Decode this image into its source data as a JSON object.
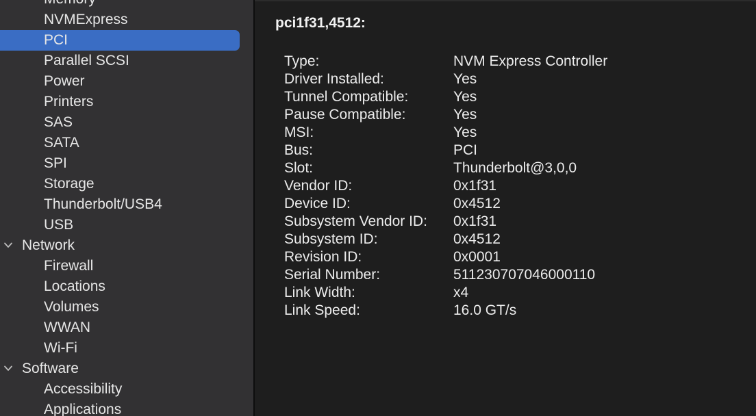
{
  "sidebar": {
    "items": [
      {
        "label": "Memory",
        "kind": "child"
      },
      {
        "label": "NVMExpress",
        "kind": "child"
      },
      {
        "label": "PCI",
        "kind": "child",
        "selected": true
      },
      {
        "label": "Parallel SCSI",
        "kind": "child"
      },
      {
        "label": "Power",
        "kind": "child"
      },
      {
        "label": "Printers",
        "kind": "child"
      },
      {
        "label": "SAS",
        "kind": "child"
      },
      {
        "label": "SATA",
        "kind": "child"
      },
      {
        "label": "SPI",
        "kind": "child"
      },
      {
        "label": "Storage",
        "kind": "child"
      },
      {
        "label": "Thunderbolt/USB4",
        "kind": "child"
      },
      {
        "label": "USB",
        "kind": "child"
      },
      {
        "label": "Network",
        "kind": "group"
      },
      {
        "label": "Firewall",
        "kind": "child"
      },
      {
        "label": "Locations",
        "kind": "child"
      },
      {
        "label": "Volumes",
        "kind": "child"
      },
      {
        "label": "WWAN",
        "kind": "child"
      },
      {
        "label": "Wi-Fi",
        "kind": "child"
      },
      {
        "label": "Software",
        "kind": "group"
      },
      {
        "label": "Accessibility",
        "kind": "child"
      },
      {
        "label": "Applications",
        "kind": "child"
      }
    ],
    "selected_color": "#3a6dc4",
    "background_color": "#323133",
    "group_icon": "chevron-down-icon"
  },
  "detail": {
    "title": "pci1f31,4512:",
    "properties": [
      {
        "key": "Type:",
        "value": "NVM Express Controller"
      },
      {
        "key": "Driver Installed:",
        "value": "Yes"
      },
      {
        "key": "Tunnel Compatible:",
        "value": "Yes"
      },
      {
        "key": "Pause Compatible:",
        "value": "Yes"
      },
      {
        "key": "MSI:",
        "value": "Yes"
      },
      {
        "key": "Bus:",
        "value": "PCI"
      },
      {
        "key": "Slot:",
        "value": "Thunderbolt@3,0,0"
      },
      {
        "key": "Vendor ID:",
        "value": "0x1f31"
      },
      {
        "key": "Device ID:",
        "value": "0x4512"
      },
      {
        "key": "Subsystem Vendor ID:",
        "value": "0x1f31"
      },
      {
        "key": "Subsystem ID:",
        "value": "0x4512"
      },
      {
        "key": "Revision ID:",
        "value": "0x0001"
      },
      {
        "key": "Serial Number:",
        "value": "511230707046000110"
      },
      {
        "key": "Link Width:",
        "value": "x4"
      },
      {
        "key": "Link Speed:",
        "value": "16.0 GT/s"
      }
    ],
    "background_color": "#1e1e1e"
  }
}
